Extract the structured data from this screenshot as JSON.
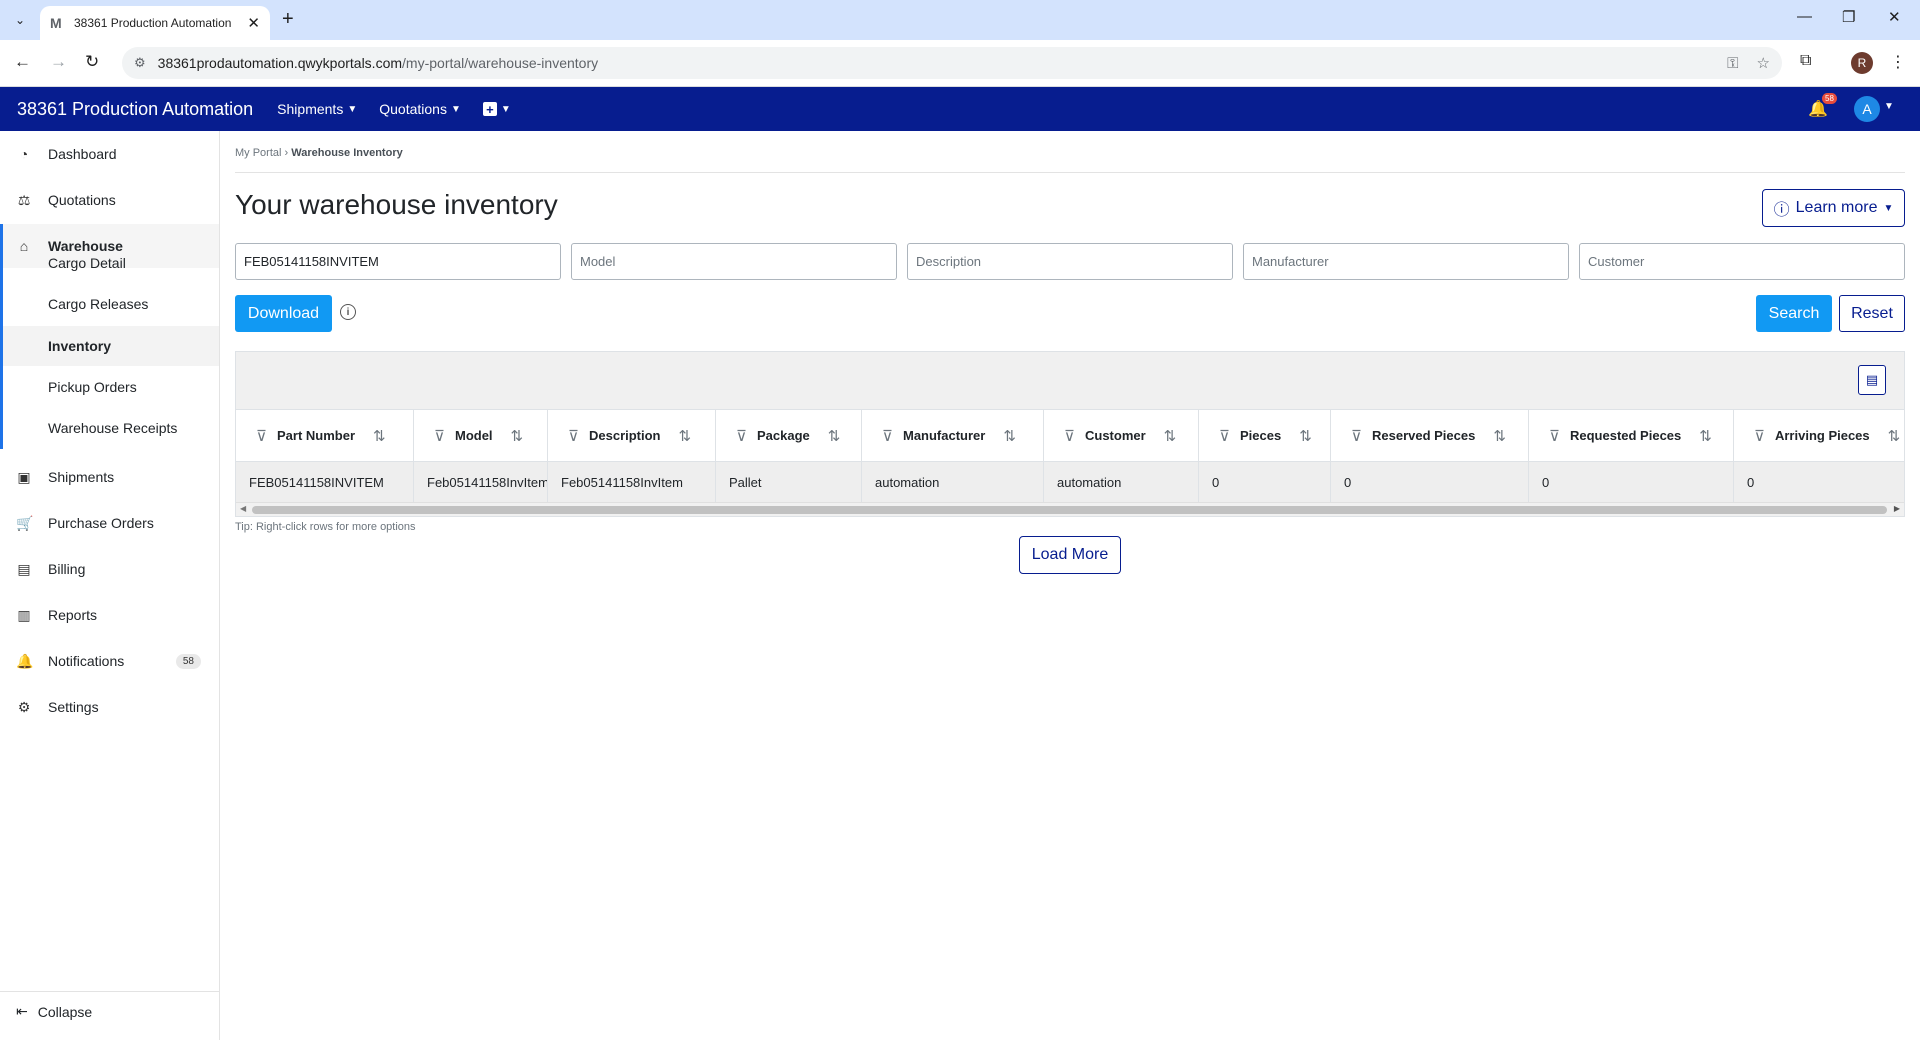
{
  "browser": {
    "tab_title": "38361 Production Automation",
    "tab_favicon": "M",
    "url_host": "38361prodautomation.qwykportals.com",
    "url_path": "/my-portal/warehouse-inventory",
    "profile_initial": "R"
  },
  "header": {
    "brand": "38361 Production Automation",
    "nav": [
      {
        "label": "Shipments"
      },
      {
        "label": "Quotations"
      }
    ],
    "notification_count": "58",
    "avatar_initial": "A"
  },
  "sidebar": {
    "items": [
      {
        "label": "Dashboard",
        "icon": "dashboard-icon"
      },
      {
        "label": "Quotations",
        "icon": "quotations-icon"
      },
      {
        "label": "Warehouse",
        "icon": "warehouse-icon"
      },
      {
        "label": "Shipments",
        "icon": "shipments-icon"
      },
      {
        "label": "Purchase Orders",
        "icon": "cart-icon"
      },
      {
        "label": "Billing",
        "icon": "billing-icon"
      },
      {
        "label": "Reports",
        "icon": "reports-icon"
      },
      {
        "label": "Notifications",
        "icon": "bell-icon",
        "badge": "58"
      },
      {
        "label": "Settings",
        "icon": "gear-icon"
      }
    ],
    "warehouse_sub": [
      "Cargo Detail",
      "Cargo Releases",
      "Inventory",
      "Pickup Orders",
      "Warehouse Receipts"
    ],
    "collapse_label": "Collapse"
  },
  "main": {
    "breadcrumb_root": "My Portal",
    "breadcrumb_sep": "›",
    "breadcrumb_current": "Warehouse Inventory",
    "title": "Your warehouse inventory",
    "learn_more": "Learn more",
    "filters": {
      "part_number_value": "FEB05141158INVITEM",
      "model_placeholder": "Model",
      "description_placeholder": "Description",
      "manufacturer_placeholder": "Manufacturer",
      "customer_placeholder": "Customer"
    },
    "download_label": "Download",
    "search_label": "Search",
    "reset_label": "Reset",
    "table": {
      "columns": [
        "Part Number",
        "Model",
        "Description",
        "Package",
        "Manufacturer",
        "Customer",
        "Pieces",
        "Reserved Pieces",
        "Requested Pieces",
        "Arriving Pieces"
      ],
      "rows": [
        [
          "FEB05141158INVITEM",
          "Feb05141158InvItem",
          "Feb05141158InvItem",
          "Pallet",
          "automation",
          "automation",
          "0",
          "0",
          "0",
          "0"
        ]
      ]
    },
    "tip": "Tip: Right-click rows for more options",
    "load_more": "Load More"
  }
}
